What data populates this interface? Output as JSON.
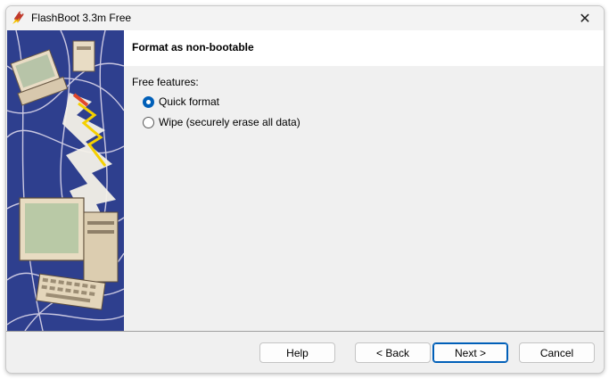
{
  "window": {
    "title": "FlashBoot 3.3m Free"
  },
  "titlebar": {
    "close_glyph": "✕",
    "app_icon": "flashboot-logo-icon",
    "close_icon": "close-icon"
  },
  "header": {
    "title": "Format as non-bootable"
  },
  "features": {
    "label": "Free features:",
    "options": [
      {
        "label": "Quick format",
        "selected": true
      },
      {
        "label": "Wipe (securely erase all data)",
        "selected": false
      }
    ]
  },
  "buttons": {
    "help": "Help",
    "back": "< Back",
    "next": "Next >",
    "cancel": "Cancel"
  },
  "colors": {
    "accent": "#005fb8",
    "art_background": "#2e3f8e"
  }
}
